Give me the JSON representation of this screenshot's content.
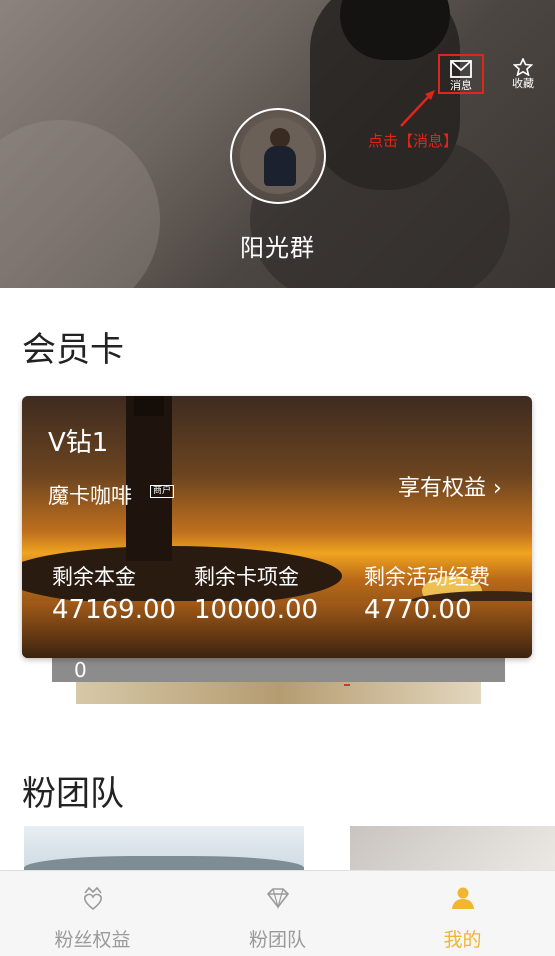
{
  "header": {
    "username": "阳光群",
    "messages_label": "消息",
    "favorites_label": "收藏",
    "hint_text": "点击【消息】"
  },
  "member_card_section": {
    "title": "会员卡"
  },
  "card": {
    "level": "V钻1",
    "merchant_name": "魔卡咖啡",
    "merchant_tag": "商户",
    "benefits_label": "享有权益",
    "benefits_chevron": "›",
    "stats": [
      {
        "label": "剩余本金",
        "value": "47169.00"
      },
      {
        "label": "剩余卡项金",
        "value": "10000.00"
      },
      {
        "label": "剩余活动经费",
        "value": "4770.00"
      }
    ],
    "stacked_card_value": "0"
  },
  "team_section": {
    "title": "粉团队"
  },
  "tabbar": {
    "tabs": [
      {
        "label": "粉丝权益",
        "icon": "crown-heart-icon"
      },
      {
        "label": "粉团队",
        "icon": "diamond-icon"
      },
      {
        "label": "我的",
        "icon": "person-icon",
        "active": true
      }
    ],
    "active_color": "#f0b632",
    "inactive_color": "#9a9a9a"
  },
  "colors": {
    "highlight_red": "#e1251b"
  }
}
